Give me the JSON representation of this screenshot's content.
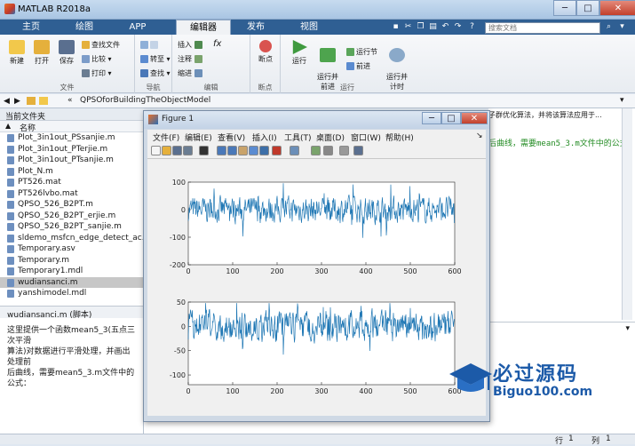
{
  "window": {
    "title": "MATLAB R2018a"
  },
  "tabs": [
    "主页",
    "绘图",
    "APP",
    "编辑器",
    "发布",
    "视图"
  ],
  "search": {
    "placeholder": "搜索文档"
  },
  "ribbon": {
    "file_group": {
      "label": "文件",
      "new": "新建",
      "open": "打开",
      "save": "保存",
      "find_files": "查找文件",
      "compare": "比较",
      "print": "打印"
    },
    "nav_group": {
      "label": "导航",
      "goto": "转至",
      "find": "查找"
    },
    "edit_group": {
      "label": "编辑",
      "insert": "插入",
      "comment": "注释",
      "indent": "缩进",
      "fx": "fx"
    },
    "breakpoints_group": {
      "label": "断点",
      "breakpoints": "断点"
    },
    "run_group": {
      "label": "运行",
      "run": "运行",
      "run_advance": "运行并\n前进",
      "run_section": "运行节",
      "advance": "前进",
      "run_time": "运行并\n计时"
    }
  },
  "address": {
    "path": "QPSOforBuildingTheObjectModel"
  },
  "left_panel": {
    "title": "当前文件夹",
    "name_header": "名称",
    "files": [
      "Plot_3in1out_PSsanjie.m",
      "Plot_3in1out_PTerjie.m",
      "Plot_3in1out_PTsanjie.m",
      "Plot_N.m",
      "PT526.mat",
      "PT526lvbo.mat",
      "QPSO_526_B2PT.m",
      "QPSO_526_B2PT_erjie.m",
      "QPSO_526_B2PT_sanjie.m",
      "sldemo_msfcn_edge_detect_ac...",
      "Temporary.asv",
      "Temporary.m",
      "Temporary1.mdl",
      "wudiansanci.m",
      "yanshimodel.mdl"
    ],
    "selected_index": 13
  },
  "details": {
    "label": "wudiansanci.m  (脚本)",
    "text": [
      "这里提供一个函数mean5_3(五点三次平滑",
      "算法)对数据进行平滑处理，并画出处理前",
      "后曲线，需要mean5_3.m文件中的公式："
    ]
  },
  "editor": {
    "top_text": "子群优化算法，并将该算法应用于...",
    "line_text": "后曲线，需要mean5_3.m文件中的公式"
  },
  "status": {
    "row_label": "行",
    "row": "1",
    "col_label": "列",
    "col": "1"
  },
  "figure": {
    "title": "Figure 1",
    "menu": [
      "文件(F)",
      "编辑(E)",
      "查看(V)",
      "插入(I)",
      "工具(T)",
      "桌面(D)",
      "窗口(W)",
      "帮助(H)"
    ],
    "toolbar_icons": [
      "new-figure-icon",
      "open-icon",
      "save-icon",
      "print-icon",
      "pointer-icon",
      "zoom-in-icon",
      "zoom-out-icon",
      "pan-icon",
      "rotate-icon",
      "data-cursor-icon",
      "brush-icon",
      "link-icon",
      "colorbar-icon",
      "legend-icon",
      "hide-tools-icon",
      "show-tools-icon"
    ]
  },
  "watermark": {
    "text": "必过源码",
    "url": "Biguo100.com"
  },
  "colors": {
    "line": "#1f77b4",
    "tab_bar": "#2f5f93",
    "selected_row": "#c7c7c7"
  },
  "chart_data": [
    {
      "type": "line",
      "xlim": [
        0,
        600
      ],
      "ylim": [
        -200,
        100
      ],
      "xticks": [
        "0",
        "100",
        "200",
        "300",
        "400",
        "500",
        "600"
      ],
      "yticks": [
        "100",
        "0",
        "-100",
        "-200"
      ],
      "series": [
        {
          "seed": 7,
          "n": 600,
          "amplitude": 45,
          "spike": 70
        }
      ]
    },
    {
      "type": "line",
      "xlim": [
        0,
        600
      ],
      "ylim": [
        -120,
        50
      ],
      "xticks": [
        "0",
        "100",
        "200",
        "300",
        "400",
        "500",
        "600"
      ],
      "yticks": [
        "50",
        "0",
        "-50",
        "-100"
      ],
      "series": [
        {
          "seed": 13,
          "n": 600,
          "amplitude": 30,
          "spike": 40
        }
      ]
    }
  ]
}
